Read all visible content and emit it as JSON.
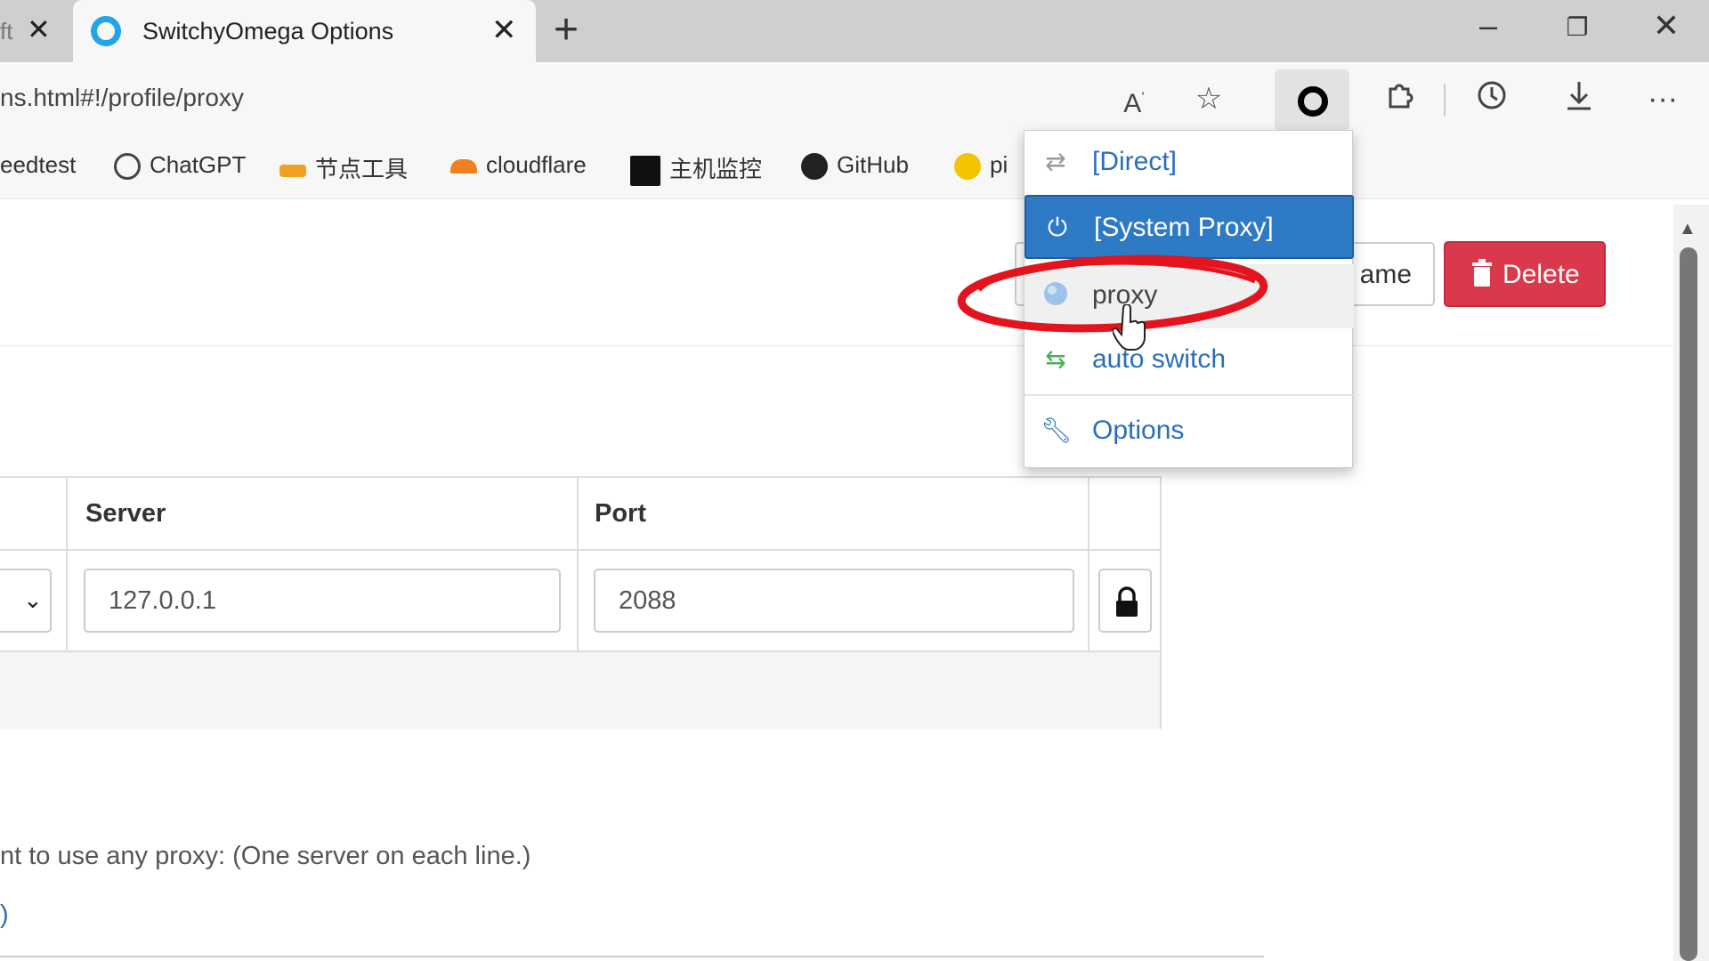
{
  "tabs": {
    "prev_fragment": "ft",
    "active_title": "SwitchyOmega Options"
  },
  "toolbar": {
    "url": "ns.html#!/profile/proxy"
  },
  "bookmarks": [
    {
      "label": "eedtest"
    },
    {
      "label": "ChatGPT"
    },
    {
      "label": "节点工具"
    },
    {
      "label": "cloudflare"
    },
    {
      "label": "主机监控"
    },
    {
      "label": "GitHub"
    },
    {
      "label": "pi"
    }
  ],
  "page": {
    "rename_fragment": "ame",
    "delete_label": "Delete",
    "table": {
      "server_header": "Server",
      "port_header": "Port",
      "server_value": "127.0.0.1",
      "port_value": "2088"
    },
    "bypass_text": "nt to use any proxy: (One server on each line.)",
    "paren_text": ")"
  },
  "menu": {
    "items": [
      {
        "label": "[Direct]",
        "icon": "direct-arrows-icon"
      },
      {
        "label": "[System Proxy]",
        "icon": "power-icon",
        "selected": true
      },
      {
        "label": "proxy",
        "icon": "globe-icon",
        "hovered": true
      },
      {
        "label": "auto switch",
        "icon": "switch-arrows-icon"
      },
      {
        "label": "Options",
        "icon": "wrench-icon"
      }
    ]
  },
  "colors": {
    "selected_item": "#2f7ac4",
    "delete_button": "#d9394a",
    "link_blue": "#2a6ebb",
    "annotation_red": "#e3141d"
  }
}
